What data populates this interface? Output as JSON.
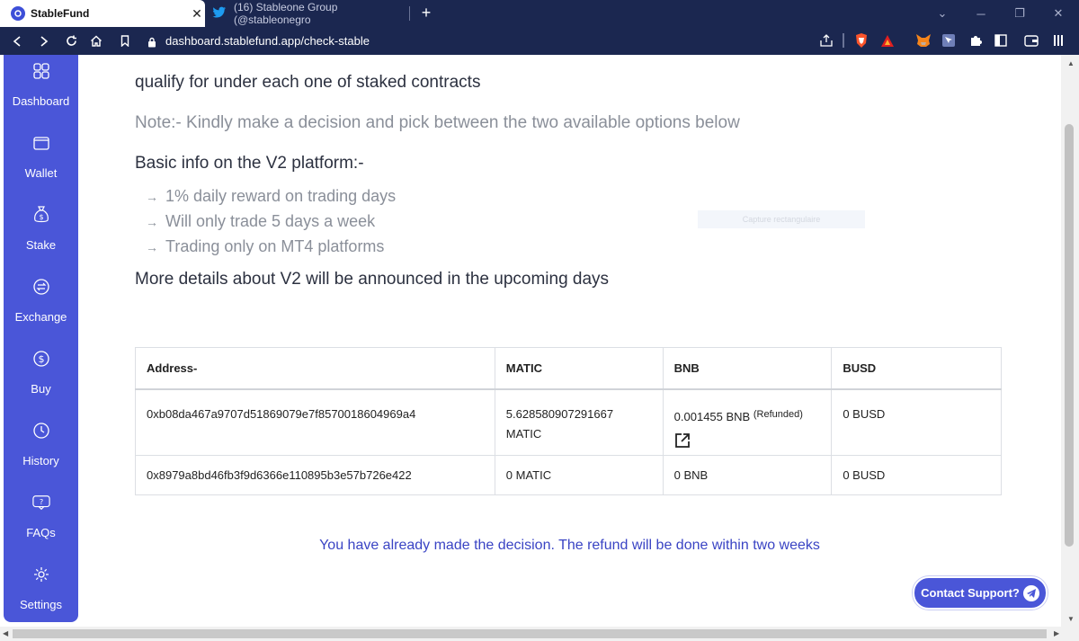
{
  "browser": {
    "active_tab": {
      "title": "StableFund"
    },
    "inactive_tab": {
      "title": "(16) Stableone Group (@stableonegro"
    },
    "url": "dashboard.stablefund.app/check-stable",
    "icons": [
      "back-icon",
      "forward-icon",
      "reload-icon",
      "home-icon",
      "bookmark-icon",
      "lock-icon",
      "share-icon",
      "brave-shield-icon",
      "brave-rewards-icon",
      "metamask-icon",
      "extension-icon",
      "puzzle-icon",
      "sidebar-icon",
      "wallet-icon",
      "menu-icon"
    ]
  },
  "sidebar": {
    "items": [
      {
        "label": "Dashboard",
        "icon": "dashboard-icon"
      },
      {
        "label": "Wallet",
        "icon": "wallet-icon"
      },
      {
        "label": "Stake",
        "icon": "moneybag-icon"
      },
      {
        "label": "Exchange",
        "icon": "exchange-icon"
      },
      {
        "label": "Buy",
        "icon": "dollar-icon"
      },
      {
        "label": "History",
        "icon": "clock-icon"
      },
      {
        "label": "FAQs",
        "icon": "question-icon"
      },
      {
        "label": "Settings",
        "icon": "gear-icon"
      }
    ]
  },
  "main": {
    "line1": "qualify for under each one of staked contracts",
    "note": "Note:-  Kindly make a decision and pick between the two available options below",
    "basic_info": "Basic info on the V2 platform:-",
    "bullets": [
      "1% daily reward on trading days",
      "Will only trade 5 days a week",
      "Trading only on MT4 platforms"
    ],
    "more_details": "More details about V2 will be announced in the upcoming days",
    "capture_overlay": "Capture rectangulaire",
    "table": {
      "headers": [
        "Address-",
        "MATIC",
        "BNB",
        "BUSD"
      ],
      "rows": [
        {
          "address": "0xb08da467a9707d51869079e7f8570018604969a4",
          "matic": "5.628580907291667",
          "matic_unit": "MATIC",
          "bnb": "0.001455 BNB",
          "bnb_note": "(Refunded)",
          "busd": "0 BUSD"
        },
        {
          "address": "0x8979a8bd46fb3f9d6366e110895b3e57b726e422",
          "matic": "0 MATIC",
          "bnb": "0 BNB",
          "busd": "0 BUSD"
        }
      ]
    },
    "decision_msg": "You have already made the decision. The refund will be done within two weeks",
    "support_button": "Contact Support?"
  },
  "colors": {
    "sidebar": "#4a56d8",
    "chrome": "#1b2750",
    "accent_text": "#3a44c4"
  }
}
